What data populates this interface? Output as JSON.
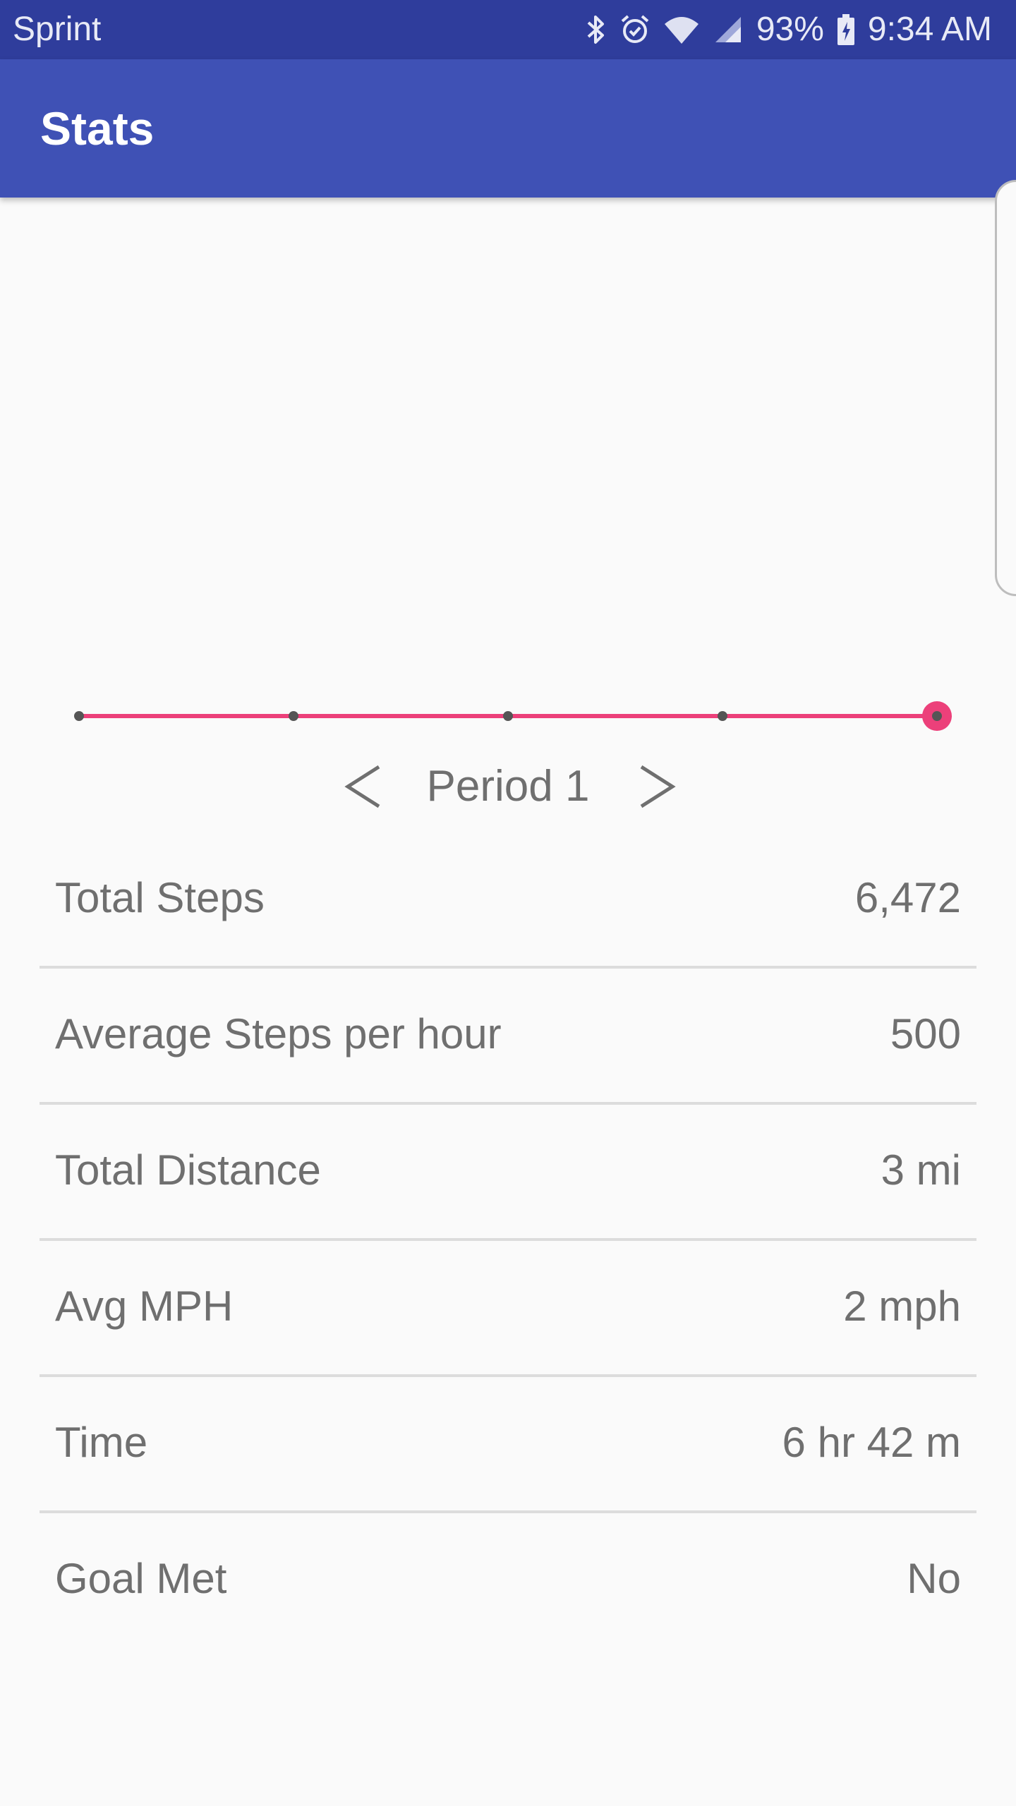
{
  "status_bar": {
    "carrier": "Sprint",
    "battery": "93%",
    "time": "9:34 AM",
    "icons": [
      "bluetooth-icon",
      "alarm-icon",
      "wifi-icon",
      "cell-signal-icon",
      "battery-charging-icon"
    ]
  },
  "app_bar": {
    "title": "Stats"
  },
  "timeline": {
    "points": 5,
    "selected_index": 4,
    "line_color": "#ec407a",
    "dot_color": "#555555"
  },
  "period_nav": {
    "label": "Period 1",
    "prev_icon": "chevron-left-icon",
    "next_icon": "chevron-right-icon"
  },
  "stats": [
    {
      "label": "Total Steps",
      "value": "6,472"
    },
    {
      "label": "Average Steps per hour",
      "value": "500"
    },
    {
      "label": "Total Distance",
      "value": "3 mi"
    },
    {
      "label": "Avg MPH",
      "value": "2 mph"
    },
    {
      "label": "Time",
      "value": "6 hr 42 m"
    },
    {
      "label": "Goal Met",
      "value": "No"
    }
  ],
  "colors": {
    "status_bar": "#2f3d9c",
    "app_bar": "#3f51b5",
    "accent": "#ec407a",
    "text_secondary": "#6f6f6f"
  }
}
